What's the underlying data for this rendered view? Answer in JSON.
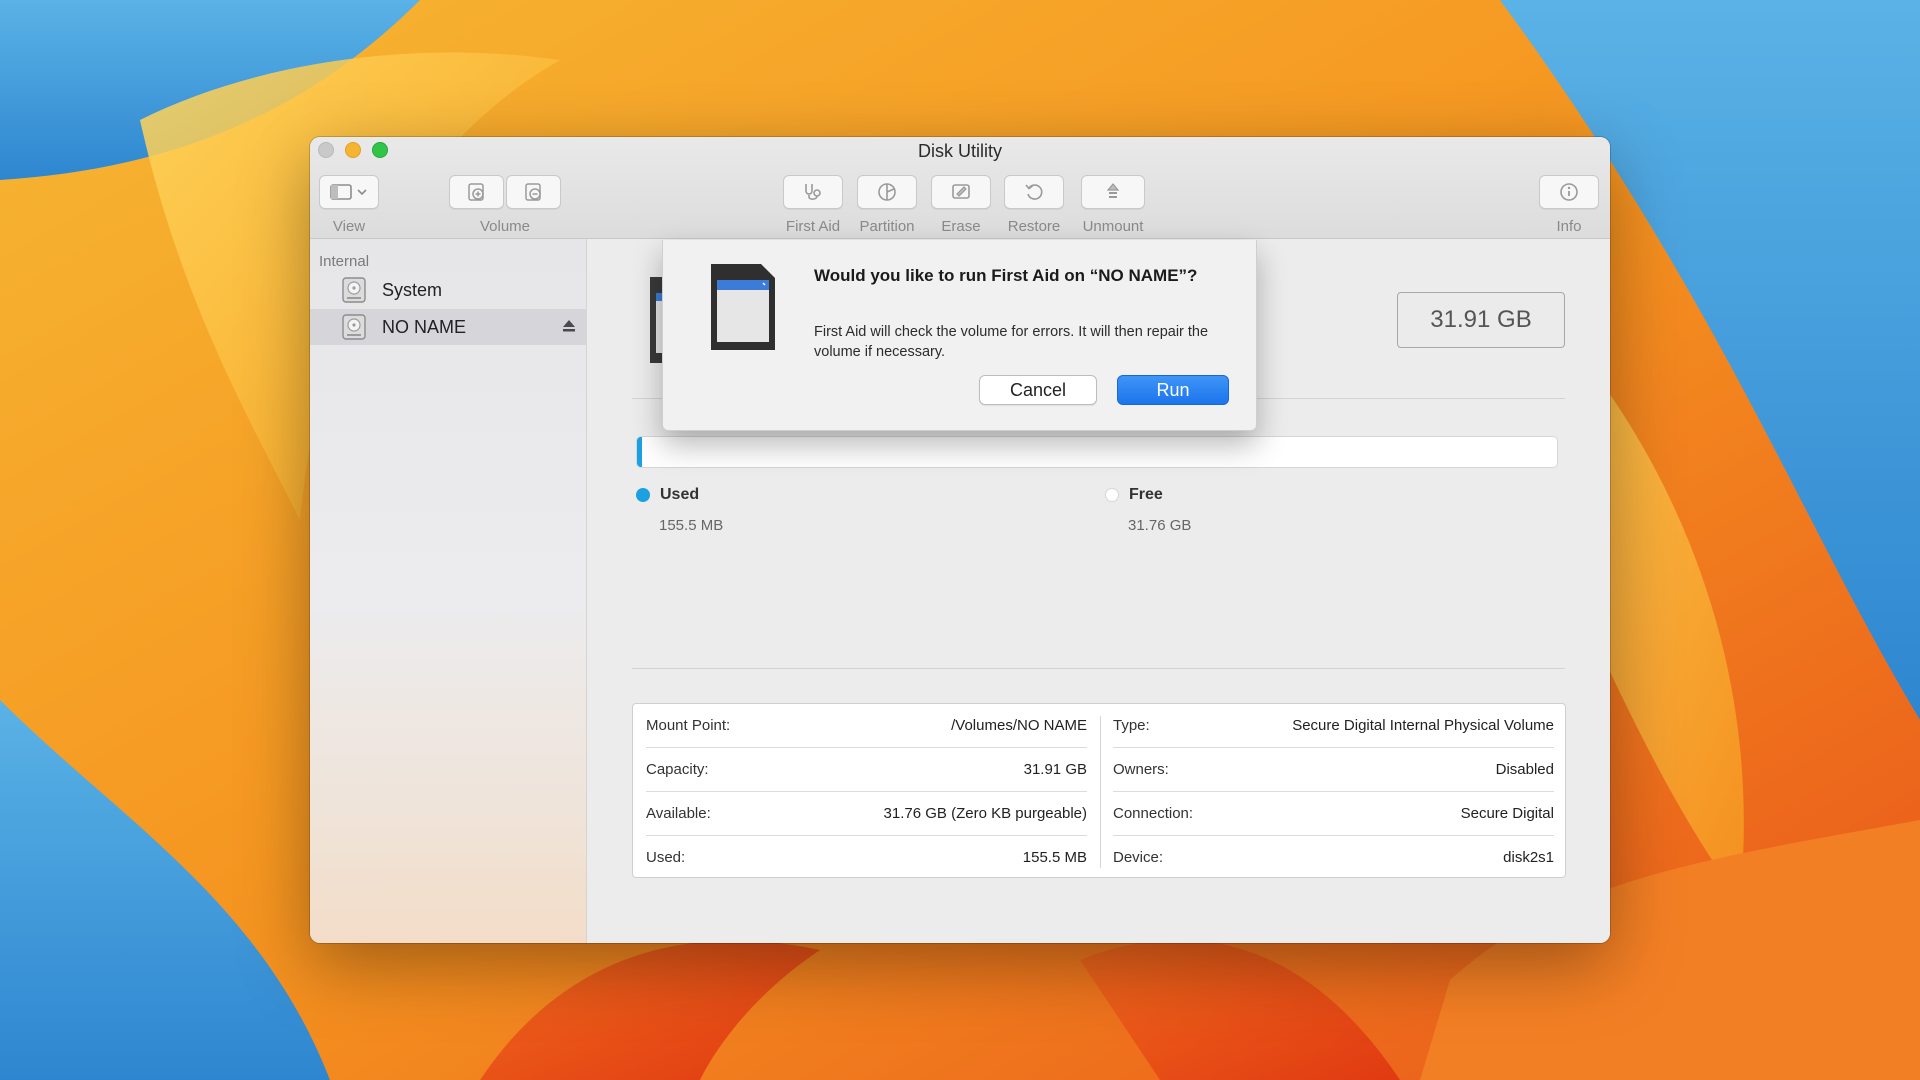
{
  "window": {
    "title": "Disk Utility"
  },
  "toolbar": {
    "view_label": "View",
    "volume_label": "Volume",
    "first_aid_label": "First Aid",
    "partition_label": "Partition",
    "erase_label": "Erase",
    "restore_label": "Restore",
    "unmount_label": "Unmount",
    "info_label": "Info"
  },
  "sidebar": {
    "section": "Internal",
    "items": [
      {
        "label": "System"
      },
      {
        "label": "NO NAME"
      }
    ]
  },
  "volume": {
    "capacity": "31.91 GB",
    "used_fraction": 0.005,
    "used": {
      "label": "Used",
      "value": "155.5 MB",
      "color": "#1ba1e2"
    },
    "free": {
      "label": "Free",
      "value": "31.76 GB",
      "color": "#ffffff"
    }
  },
  "info": {
    "left": [
      {
        "key": "Mount Point:",
        "value": "/Volumes/NO NAME"
      },
      {
        "key": "Capacity:",
        "value": "31.91 GB"
      },
      {
        "key": "Available:",
        "value": "31.76 GB (Zero KB purgeable)"
      },
      {
        "key": "Used:",
        "value": "155.5 MB"
      }
    ],
    "right": [
      {
        "key": "Type:",
        "value": "Secure Digital Internal Physical Volume"
      },
      {
        "key": "Owners:",
        "value": "Disabled"
      },
      {
        "key": "Connection:",
        "value": "Secure Digital"
      },
      {
        "key": "Device:",
        "value": "disk2s1"
      }
    ]
  },
  "dialog": {
    "title": "Would you like to run First Aid on “NO NAME”?",
    "message": "First Aid will check the volume for errors. It will then repair the volume if necessary.",
    "cancel_label": "Cancel",
    "run_label": "Run"
  },
  "colors": {
    "accent": "#1c74ec",
    "used_bar": "#1ba1e2"
  }
}
